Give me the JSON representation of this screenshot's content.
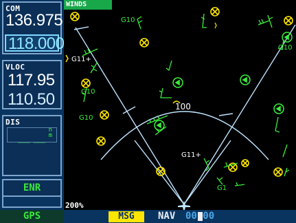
{
  "com": {
    "label": "COM",
    "active": "136.975",
    "standby": "118.000"
  },
  "vloc": {
    "label": "VLOC",
    "active": "117.95",
    "standby": "110.50"
  },
  "dis": {
    "label": "DIS",
    "value": "___ ___",
    "unit_top": "n",
    "unit_bottom": "m"
  },
  "mode": {
    "label": "ENR"
  },
  "map": {
    "overlay_tag": "WINDS",
    "range_label": "200%",
    "arc_label": "100",
    "stations": [
      "G10",
      "G11+",
      "G10",
      "G10",
      "G11+",
      "G10",
      "G1"
    ]
  },
  "status_bar": {
    "gps": "GPS",
    "msg": "MSG",
    "nav": "NAV",
    "nav_readout": "00 00"
  },
  "colors": {
    "panel": "#0a3460",
    "border": "#7fa6cc",
    "map_lines": "#bfe4ff",
    "symbols": "#ffff00",
    "wind_barbs": "#3af03a",
    "msg": "#ffe600"
  }
}
